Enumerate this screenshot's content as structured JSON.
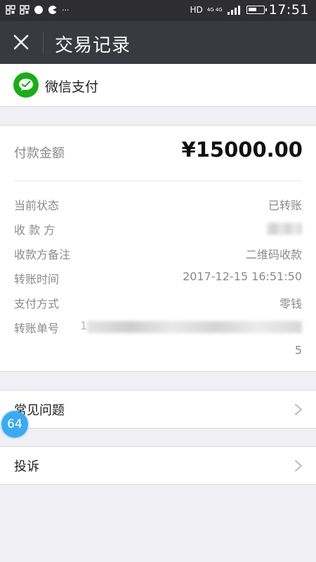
{
  "status_bar": {
    "network_hd": "HD",
    "network_4g": "4G 4G",
    "time": "17:51",
    "more": "···",
    "battery_level": 0.6
  },
  "topbar": {
    "title": "交易记录",
    "close_icon": "close-icon"
  },
  "pay_header": {
    "logo_icon": "wechat-pay-icon",
    "name": "微信支付",
    "brand_color": "#1aad19"
  },
  "details": {
    "amount_label": "付款金额",
    "amount_value": "¥15000.00",
    "rows": [
      {
        "key": "当前状态",
        "value": "已转账"
      },
      {
        "key": "收 款 方",
        "value": ""
      },
      {
        "key": "收款方备注",
        "value": "二维码收款"
      },
      {
        "key": "转账时间",
        "value": "2017-12-15 16:51:50"
      },
      {
        "key": "支付方式",
        "value": "零钱"
      },
      {
        "key": "转账单号",
        "value": "1",
        "value_tail": "5"
      }
    ]
  },
  "links": {
    "faq": "常见问题",
    "complaint": "投诉"
  },
  "floating_badge": "64",
  "colors": {
    "topbar_bg": "#393a3f",
    "statusbar_bg": "#2e2e32",
    "page_bg": "#efeff4",
    "badge_bg": "#3ca9f0"
  }
}
